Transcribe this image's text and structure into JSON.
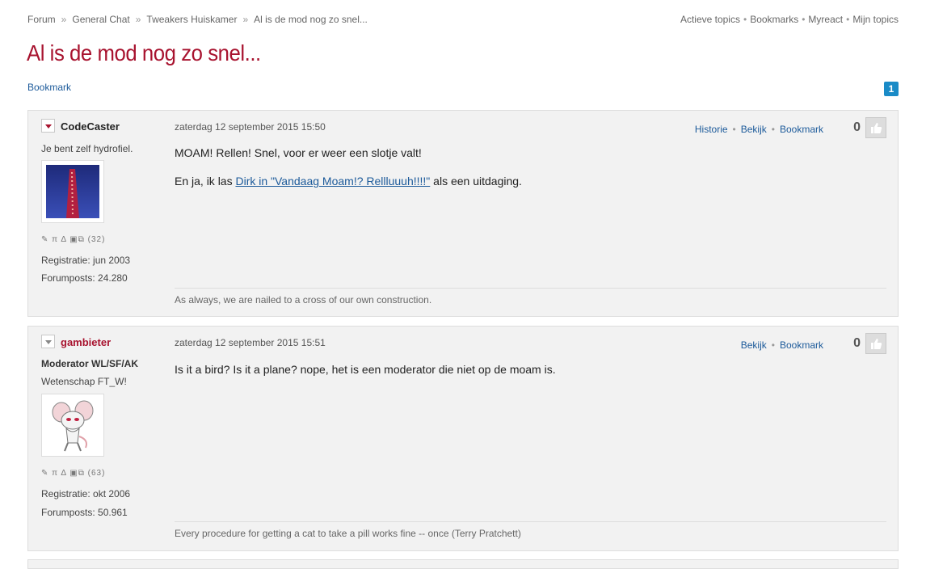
{
  "breadcrumb": [
    "Forum",
    "General Chat",
    "Tweakers Huiskamer",
    "Al is de mod nog zo snel..."
  ],
  "top_links": [
    "Actieve topics",
    "Bookmarks",
    "Myreact",
    "Mijn topics"
  ],
  "page_title": "Al is de mod nog zo snel...",
  "bookmark_label": "Bookmark",
  "page_number": "1",
  "posts": [
    {
      "username": "CodeCaster",
      "user_text": "Je bent zelf hydrofiel.",
      "date": "zaterdag 12 september 2015 15:50",
      "actions": [
        "Historie",
        "Bekijk",
        "Bookmark"
      ],
      "score": "0",
      "icon_count": "(32)",
      "registration": "Registratie: jun 2003",
      "forumposts": "Forumposts: 24.280",
      "body_line1": "MOAM! Rellen! Snel, voor er weer een slotje valt!",
      "body_line2_pre": "En ja, ik las ",
      "body_line2_link": "Dirk in \"Vandaag Moam!? Rellluuuh!!!!\"",
      "body_line2_post": " als een uitdaging.",
      "signature": "As always, we are nailed to a cross of our own construction."
    },
    {
      "username": "gambieter",
      "role": "Moderator WL/SF/AK",
      "user_text": "Wetenschap FT_W!",
      "date": "zaterdag 12 september 2015 15:51",
      "actions": [
        "Bekijk",
        "Bookmark"
      ],
      "score": "0",
      "icon_count": "(63)",
      "registration": "Registratie: okt 2006",
      "forumposts": "Forumposts: 50.961",
      "body_line1": "Is it a bird? Is it a plane? nope, het is een moderator die niet op de moam is.",
      "signature": "Every procedure for getting a cat to take a pill works fine -- once (Terry Pratchett)"
    }
  ],
  "colors": {
    "accent": "#a8132f",
    "link": "#1c5a9a",
    "badge": "#1a8bc7"
  }
}
